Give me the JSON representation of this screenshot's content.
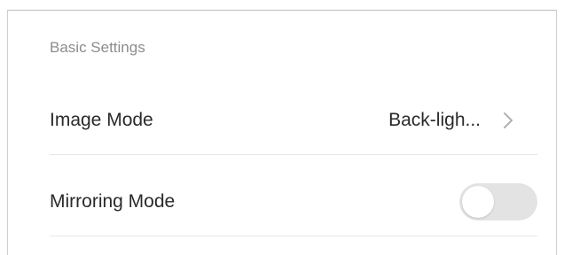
{
  "section": {
    "title": "Basic Settings"
  },
  "settings": [
    {
      "label": "Image Mode",
      "value": "Back-ligh...",
      "icon": "chevron-right-icon"
    },
    {
      "label": "Mirroring Mode",
      "toggle_on": false
    }
  ],
  "colors": {
    "toggle_off_track": "#e3e3e3",
    "section_title": "#8c8c8c",
    "divider": "#e6e6e6"
  }
}
